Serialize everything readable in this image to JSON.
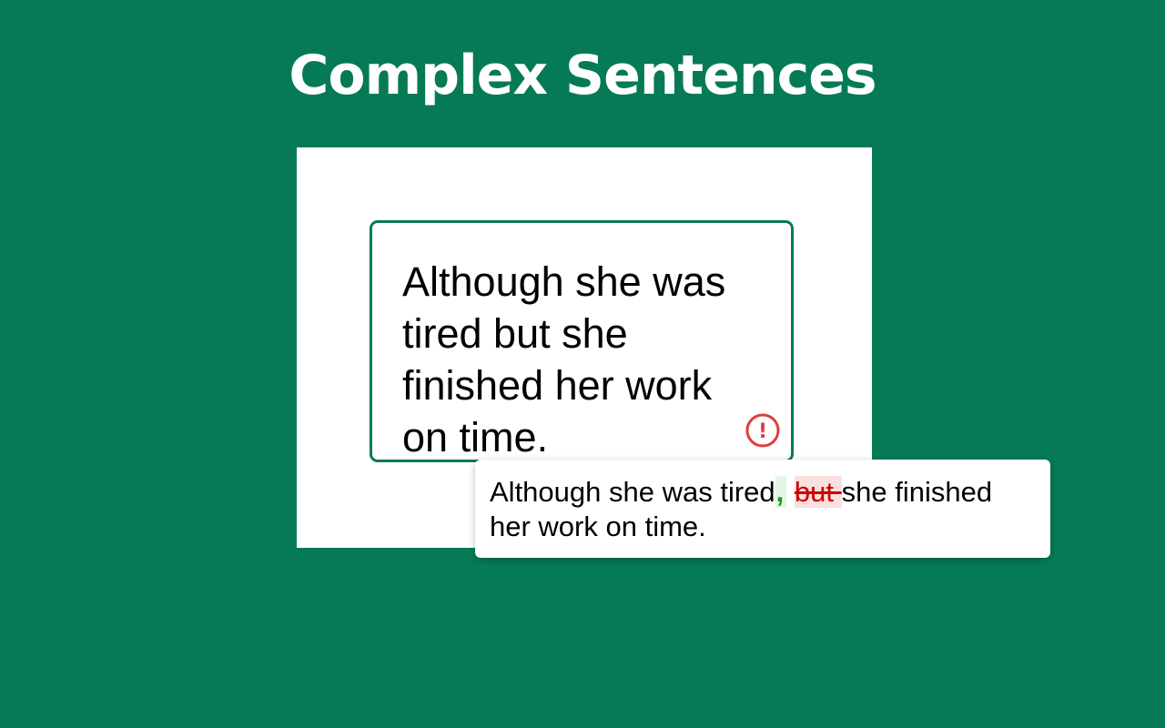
{
  "page": {
    "title": "Complex Sentences"
  },
  "editor": {
    "text": "Although she was tired but she finished her work on time."
  },
  "error_indicator": {
    "icon": "exclamation-circle-icon",
    "glyph": "!",
    "color": "#e03c3c"
  },
  "suggestion": {
    "before": "Although she was tired",
    "inserted": ",",
    "space": " ",
    "deleted": "but ",
    "after": "she finished her work on time."
  },
  "colors": {
    "background": "#067a57",
    "accent": "#067a57",
    "error": "#e03c3c",
    "insert": "#1a9c1a",
    "delete": "#cc0000"
  }
}
